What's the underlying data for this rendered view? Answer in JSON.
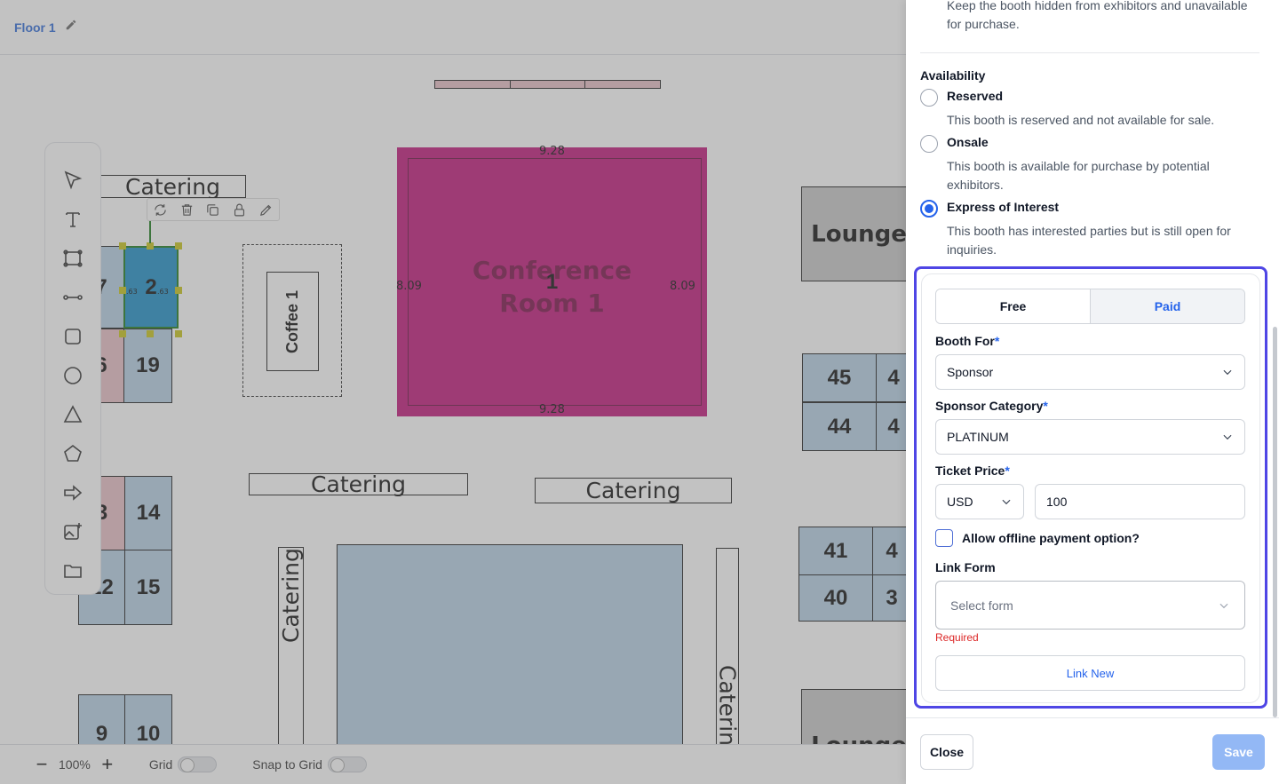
{
  "header": {
    "floor_name": "Floor 1"
  },
  "floorplan": {
    "booths": [
      {
        "label": "7"
      },
      {
        "label": "2"
      },
      {
        "label": "6"
      },
      {
        "label": "19"
      },
      {
        "label": "3"
      },
      {
        "label": "14"
      },
      {
        "label": "12"
      },
      {
        "label": "15"
      },
      {
        "label": "9"
      },
      {
        "label": "10"
      },
      {
        "label": "45"
      },
      {
        "label": "4"
      },
      {
        "label": "44"
      },
      {
        "label": "4"
      },
      {
        "label": "41"
      },
      {
        "label": "4"
      },
      {
        "label": "40"
      },
      {
        "label": "3"
      }
    ],
    "catering_label": "Catering",
    "coffee_label": "Coffee 1",
    "conference": {
      "title": "Conference Room 1",
      "number": "1"
    },
    "lounge_label": "Lounge",
    "dimensions": {
      "width": "9.28",
      "height": "8.09",
      "small": ".63"
    }
  },
  "bottombar": {
    "zoom": "100%",
    "grid_label": "Grid",
    "snap_label": "Snap to Grid"
  },
  "panel": {
    "hidden_desc": "Keep the booth hidden from exhibitors and unavailable for purchase.",
    "availability": {
      "title": "Availability",
      "options": [
        {
          "label": "Reserved",
          "desc": "This booth is reserved and not available for sale."
        },
        {
          "label": "Onsale",
          "desc": "This booth is available for purchase by potential exhibitors."
        },
        {
          "label": "Express of Interest",
          "desc": "This booth has interested parties but is still open for inquiries."
        }
      ],
      "selected": "Express of Interest"
    },
    "pricing": {
      "free_label": "Free",
      "paid_label": "Paid",
      "booth_for_label": "Booth For",
      "booth_for_value": "Sponsor",
      "sponsor_category_label": "Sponsor Category",
      "sponsor_category_value": "PLATINUM",
      "ticket_price_label": "Ticket Price",
      "currency": "USD",
      "price": "100",
      "offline_label": "Allow offline payment option?",
      "link_form_label": "Link Form",
      "link_form_placeholder": "Select form",
      "required_error": "Required",
      "link_new_label": "Link New",
      "required_mark": "*"
    },
    "footer": {
      "close_label": "Close",
      "save_label": "Save"
    }
  },
  "colors": {
    "accent": "#2563eb",
    "highlight_border": "#4f46e5",
    "conference": "#7b154f",
    "selected_booth": "#1e90c8"
  }
}
